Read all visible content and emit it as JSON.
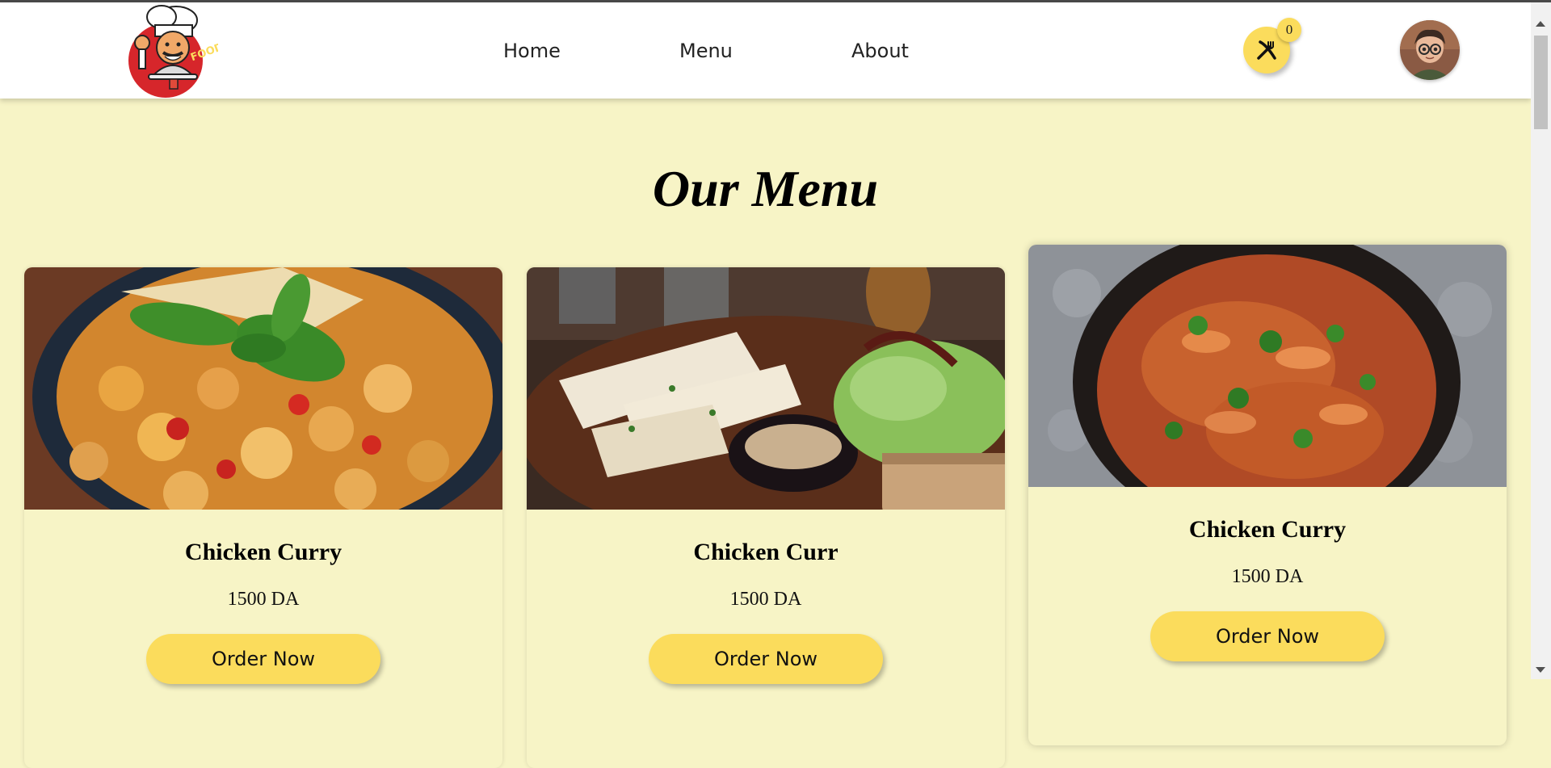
{
  "nav": {
    "links": [
      "Home",
      "Menu",
      "About"
    ],
    "logo_text": "FOOD",
    "cart_count": "0",
    "cart_icon": "fork-knife-icon",
    "avatar_icon": "user-avatar"
  },
  "main": {
    "title": "Our Menu",
    "cards": [
      {
        "name": "Chicken Curry",
        "price": "1500 DA",
        "button": "Order Now",
        "image": "chicken-skillet-with-basil"
      },
      {
        "name": "Chicken Curr",
        "price": "1500 DA",
        "button": "Order Now",
        "image": "grilled-fish-with-salad-and-sauce"
      },
      {
        "name": "Chicken Curry",
        "price": "1500 DA",
        "button": "Order Now",
        "image": "curry-in-black-pan"
      }
    ]
  },
  "colors": {
    "background": "#f7f4c6",
    "accent": "#fbdc5c",
    "navbar": "#ffffff"
  }
}
